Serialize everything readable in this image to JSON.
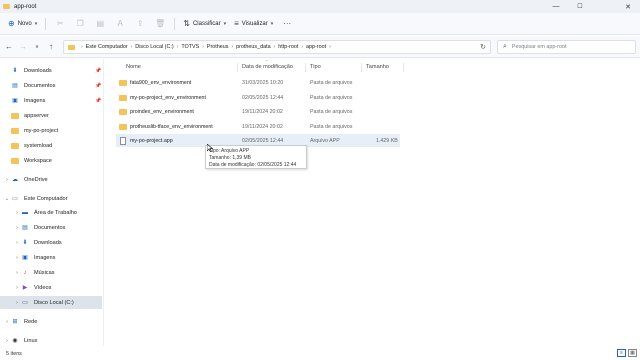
{
  "window": {
    "title": "app-root",
    "minimize_glyph": "—",
    "maximize_glyph": "☐",
    "close_glyph": "✕"
  },
  "toolbar": {
    "new_label": "Novo",
    "sort_label": "Classificar",
    "view_label": "Visualizar",
    "more_glyph": "···"
  },
  "address": {
    "crumbs": [
      "Este Computador",
      "Disco Local (C:)",
      "TOTVS",
      "Protheus",
      "protheus_data",
      "http-root",
      "app-root"
    ],
    "search_placeholder": "Pesquisar em app-root"
  },
  "sidebar": {
    "items": [
      {
        "label": "Downloads",
        "icon": "download-icon",
        "pinned": true
      },
      {
        "label": "Documentos",
        "icon": "document-icon",
        "pinned": true
      },
      {
        "label": "Imagens",
        "icon": "image-icon",
        "pinned": true
      },
      {
        "label": "appserver",
        "icon": "folder-icon",
        "pinned": false
      },
      {
        "label": "my-po-project",
        "icon": "folder-icon",
        "pinned": false
      },
      {
        "label": "systemload",
        "icon": "folder-icon",
        "pinned": false
      },
      {
        "label": "Workspace",
        "icon": "folder-icon",
        "pinned": false
      },
      {
        "label": "OneDrive",
        "icon": "cloud-icon"
      },
      {
        "label": "Este Computador",
        "icon": "computer-icon"
      },
      {
        "label": "Área de Trabalho",
        "icon": "desktop-icon"
      },
      {
        "label": "Documentos",
        "icon": "document-icon"
      },
      {
        "label": "Downloads",
        "icon": "download-icon"
      },
      {
        "label": "Imagens",
        "icon": "image-icon"
      },
      {
        "label": "Músicas",
        "icon": "music-icon"
      },
      {
        "label": "Vídeos",
        "icon": "video-icon"
      },
      {
        "label": "Disco Local (C:)",
        "icon": "drive-icon",
        "selected": true
      },
      {
        "label": "Rede",
        "icon": "network-icon"
      },
      {
        "label": "Linux",
        "icon": "linux-icon"
      }
    ]
  },
  "columns": {
    "name": "Nome",
    "modified": "Data de modificação",
    "type": "Tipo",
    "size": "Tamanho"
  },
  "files": [
    {
      "name": "fata900_env_environment",
      "modified": "31/03/2025 10:20",
      "type": "Pasta de arquivos",
      "size": "",
      "kind": "folder"
    },
    {
      "name": "my-po-project_env_environment",
      "modified": "02/05/2025 12:44",
      "type": "Pasta de arquivos",
      "size": "",
      "kind": "folder"
    },
    {
      "name": "proindex_env_environment",
      "modified": "19/11/2024 20:02",
      "type": "Pasta de arquivos",
      "size": "",
      "kind": "folder"
    },
    {
      "name": "protheuslib-tface_env_environment",
      "modified": "19/11/2024 20:02",
      "type": "Pasta de arquivos",
      "size": "",
      "kind": "folder"
    },
    {
      "name": "my-po-project.app",
      "modified": "02/05/2025 12:44",
      "type": "Arquivo APP",
      "size": "1.429 KB",
      "kind": "file",
      "hovered": true
    }
  ],
  "tooltip": {
    "line1": "Tipo: Arquivo APP",
    "line2": "Tamanho: 1,39 MB",
    "line3": "Data de modificação: 02/05/2025 12:44"
  },
  "status": {
    "count": "5 itens"
  },
  "colors": {
    "accent": "#1e63c4",
    "folder": "#f2c55c",
    "selection": "#dde3ea"
  }
}
